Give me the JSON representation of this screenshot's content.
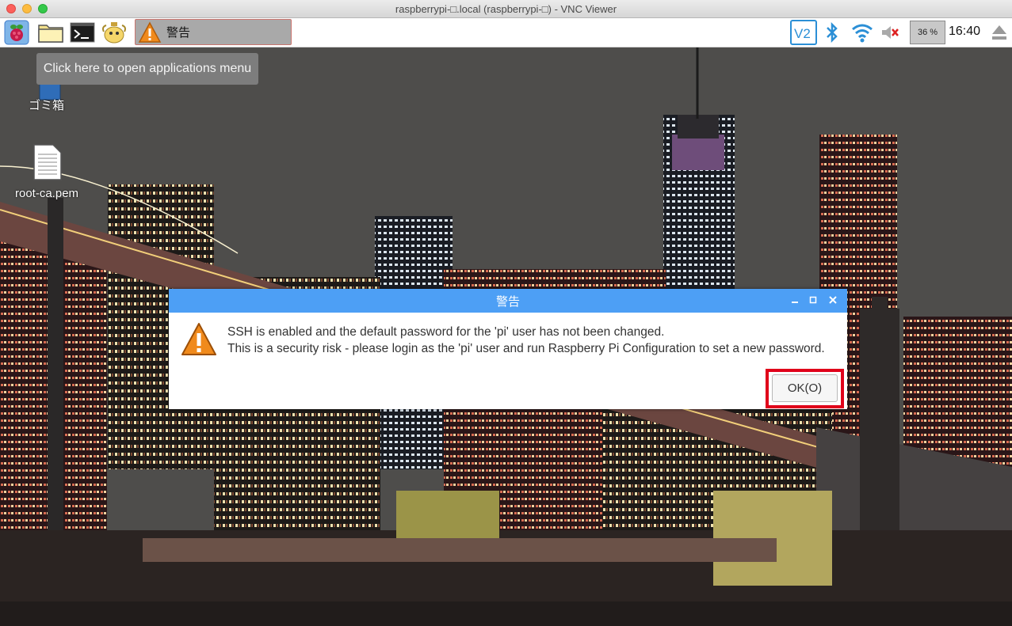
{
  "window": {
    "title": "raspberrypi-□.local (raspberrypi-□) - VNC Viewer"
  },
  "panel": {
    "task_label": "警告",
    "cpu_usage": "36 %",
    "clock": "16:40",
    "icons": [
      "raspberry-menu-icon",
      "file-manager-icon",
      "terminal-icon",
      "mathematica-icon",
      "bluetooth-icon",
      "wifi-icon",
      "volume-muted-icon",
      "eject-icon",
      "vnc-icon"
    ]
  },
  "desktop": {
    "tooltip": "Click here to open applications menu",
    "trash_label": "ゴミ箱",
    "file_label": "root-ca.pem"
  },
  "dialog": {
    "title": "警告",
    "line1": "SSH is enabled and the default password for the 'pi' user has not been changed.",
    "line2": "This is a security risk - please login as the 'pi' user and run Raspberry Pi Configuration to set a new password.",
    "ok_label": "OK(O)",
    "highlight_color": "#e0001a",
    "titlebar_color": "#4d9ff5"
  }
}
